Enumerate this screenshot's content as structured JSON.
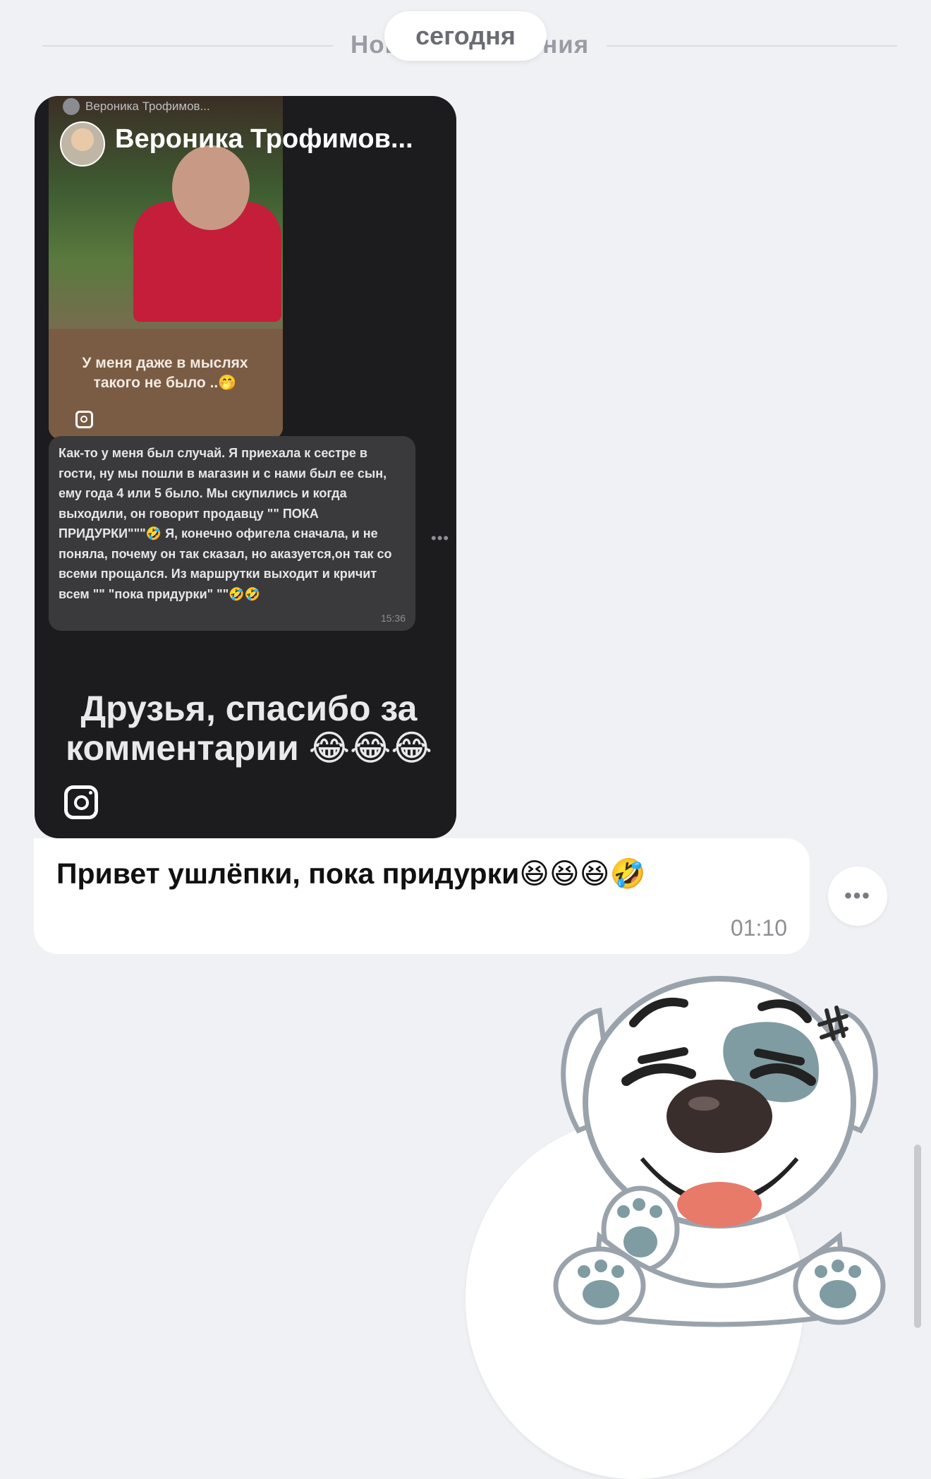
{
  "divider": {
    "new_messages_label": "Новые сообщения",
    "date_label": "сегодня"
  },
  "story": {
    "top_small_author": "Вероника Трофимов...",
    "author": "Вероника Трофимов...",
    "photo_caption": "У меня даже в мыслях такого не было ..🤭",
    "comment_text": "Как-то у меня был случай. Я приехала к сестре в гости, ну мы пошли в магазин и с нами был ее сын, ему года 4 или 5 было. Мы скупились и когда выходили, он говорит продавцу \"\" ПОКА ПРИДУРКИ\"\"\"🤣 Я, конечно офигела сначала, и не поняла, почему он так сказал, но аказуется,он так со всеми прощался. Из маршрутки выходит и кричит всем \"\" \"пока придурки\" \"\"🤣🤣",
    "comment_time": "15:36",
    "big_text": "Друзья, спасибо за комментарии 😂😂😂",
    "icon": "instagram-icon"
  },
  "message": {
    "text": "Привет ушлёпки, пока придурки😆😆😆🤣",
    "time": "01:10"
  },
  "more_icon": "•••",
  "sticker": {
    "icon": "laughing-dog-sticker"
  }
}
